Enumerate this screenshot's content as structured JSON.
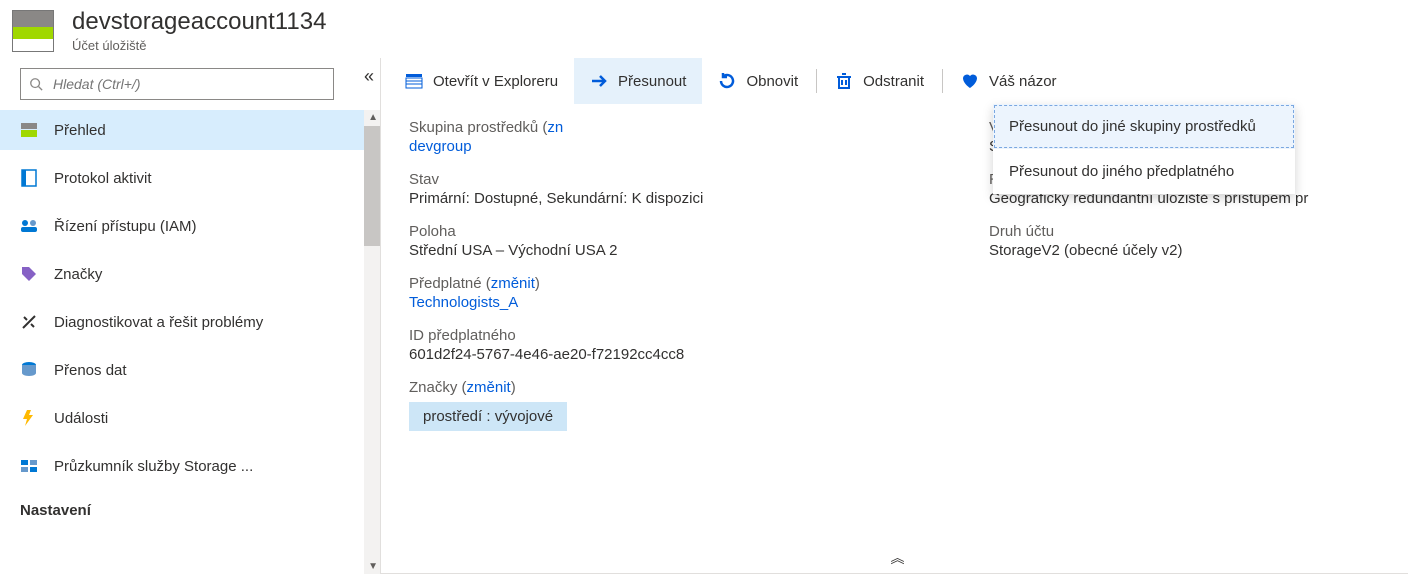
{
  "header": {
    "title": "devstorageaccount1134",
    "subtitle": "Účet úložiště"
  },
  "search": {
    "placeholder": "Hledat (Ctrl+/)"
  },
  "sidebar": {
    "items": [
      {
        "label": "Přehled"
      },
      {
        "label": "Protokol aktivit"
      },
      {
        "label": "Řízení přístupu (IAM)"
      },
      {
        "label": "Značky"
      },
      {
        "label": "Diagnostikovat a řešit problémy"
      },
      {
        "label": "Přenos dat"
      },
      {
        "label": "Události"
      },
      {
        "label": "Průzkumník služby Storage ..."
      }
    ],
    "section": "Nastavení"
  },
  "toolbar": {
    "open": "Otevřít v Exploreru",
    "move": "Přesunout",
    "refresh": "Obnovit",
    "delete": "Odstranit",
    "feedback": "Váš názor"
  },
  "dropdown": {
    "opt1": "Přesunout do jiné skupiny prostředků",
    "opt2": "Přesunout do jiného předplatného"
  },
  "essentials": {
    "rg_label": "Skupina prostředků (",
    "rg_change_prefix": "zn",
    "rg_value": "devgroup",
    "status_label": "Stav",
    "status_value": "Primární: Dostupné, Sekundární: K dispozici",
    "loc_label": "Poloha",
    "loc_value": "Střední USA – Východní USA 2",
    "sub_label": "Předplatné (",
    "change": "změnit",
    "close_paren": ")",
    "sub_value": "Technologists_A",
    "subid_label": "ID předplatného",
    "subid_value": "601d2f24-5767-4e46-ae20-f72192cc4cc8",
    "tags_label": "Značky (",
    "tag_value": "prostředí : vývojové",
    "perf_label": "Výkon/Úroveň přístupu",
    "perf_value": "Standardní/Studená",
    "repl_label": "Replikace",
    "repl_value": "Geograficky redundantní úložiště s přístupem pr",
    "kind_label": "Druh účtu",
    "kind_value": "StorageV2 (obecné účely v2)"
  }
}
